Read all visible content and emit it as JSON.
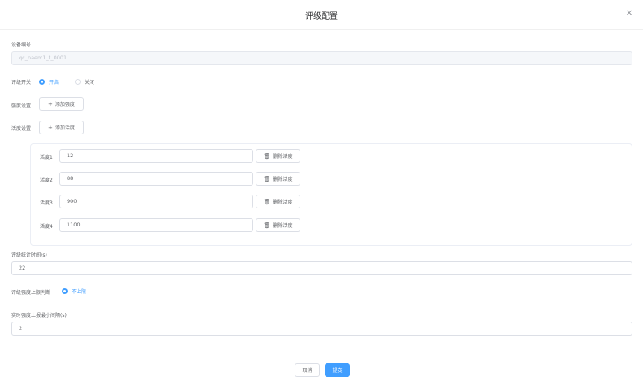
{
  "dialog": {
    "title": "评级配置",
    "close_glyph": "×"
  },
  "device": {
    "label": "设备编号",
    "value": "qc_naem1_t_0001"
  },
  "rating_switch": {
    "label": "评级开关",
    "options": [
      {
        "label": "开启",
        "checked": true
      },
      {
        "label": "关闭",
        "checked": false
      }
    ]
  },
  "strength": {
    "label": "强度设置",
    "add_label": "添加强度"
  },
  "activity": {
    "label": "活度设置",
    "add_label": "添加活度",
    "items": [
      {
        "label": "活度1",
        "value": "12",
        "delete_label": "删除活度"
      },
      {
        "label": "活度2",
        "value": "88",
        "delete_label": "删除活度"
      },
      {
        "label": "活度3",
        "value": "900",
        "delete_label": "删除活度"
      },
      {
        "label": "活度4",
        "value": "1100",
        "delete_label": "删除活度"
      }
    ]
  },
  "stat_time": {
    "label": "评级统计时间(s)",
    "value": "22"
  },
  "upper_limit": {
    "label": "评级强度上限判断",
    "option_label": "不上限",
    "checked": true
  },
  "min_interval": {
    "label": "实时强度上报最小间隔(s)",
    "value": "2"
  },
  "footer": {
    "cancel_label": "取消",
    "submit_label": "提交"
  },
  "colors": {
    "primary": "#409eff",
    "border": "#dcdfe6",
    "text": "#606266"
  }
}
